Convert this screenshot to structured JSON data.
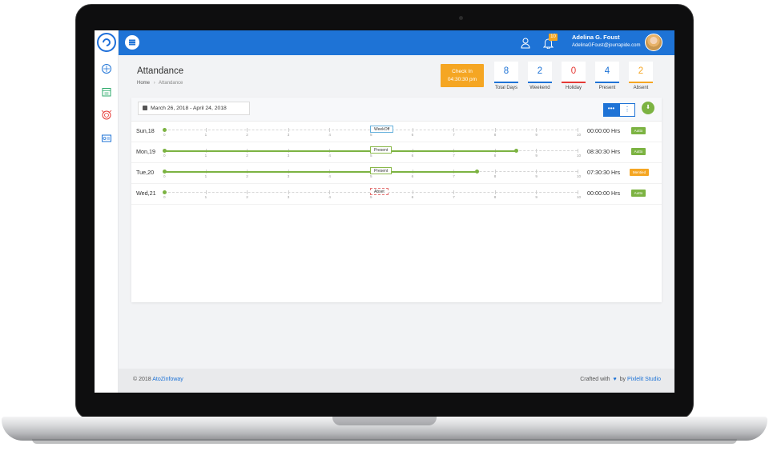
{
  "header": {
    "notification_count": "10",
    "user_name": "Adelina G. Foust",
    "user_email": "AdelinaGFoust@jourrapide.com"
  },
  "page": {
    "title": "Attandance",
    "breadcrumb_home": "Home",
    "breadcrumb_current": "Attandance"
  },
  "checkin": {
    "label": "Check In",
    "time": "04:30:30 pm"
  },
  "stats": [
    {
      "value": "8",
      "label": "Total Days",
      "color": "#1e73d6"
    },
    {
      "value": "2",
      "label": "Weekend",
      "color": "#1e73d6"
    },
    {
      "value": "0",
      "label": "Holiday",
      "color": "#e53935"
    },
    {
      "value": "4",
      "label": "Present",
      "color": "#1e73d6"
    },
    {
      "value": "2",
      "label": "Absent",
      "color": "#f5a623"
    }
  ],
  "filter": {
    "date_range": "March 26, 2018 - April 24, 2018",
    "more_h": "•••",
    "more_v": "⋮"
  },
  "timeline_ticks": [
    "0",
    "1",
    "2",
    "3",
    "4",
    "5",
    "6",
    "7",
    "8",
    "9",
    "10"
  ],
  "rows": [
    {
      "day": "Sun,18",
      "status": "WeekOff",
      "progress": 0.0,
      "hours": "00:00:00 Hrs",
      "tag": "Autto"
    },
    {
      "day": "Mon,19",
      "status": "Present",
      "progress": 0.85,
      "hours": "08:30:30 Hrs",
      "tag": "Autto"
    },
    {
      "day": "Tue,20",
      "status": "Present",
      "progress": 0.755,
      "hours": "07:30:30 Hrs",
      "tag": "Mentied"
    },
    {
      "day": "Wed,21",
      "status": "Abset",
      "progress": 0.0,
      "hours": "00:00:00 Hrs",
      "tag": "Autto"
    }
  ],
  "footer": {
    "copyright": "© 2018",
    "company": "AtoZinfoway",
    "crafted": "Crafted with",
    "by": "by",
    "studio": "Pixlelit Studio"
  }
}
